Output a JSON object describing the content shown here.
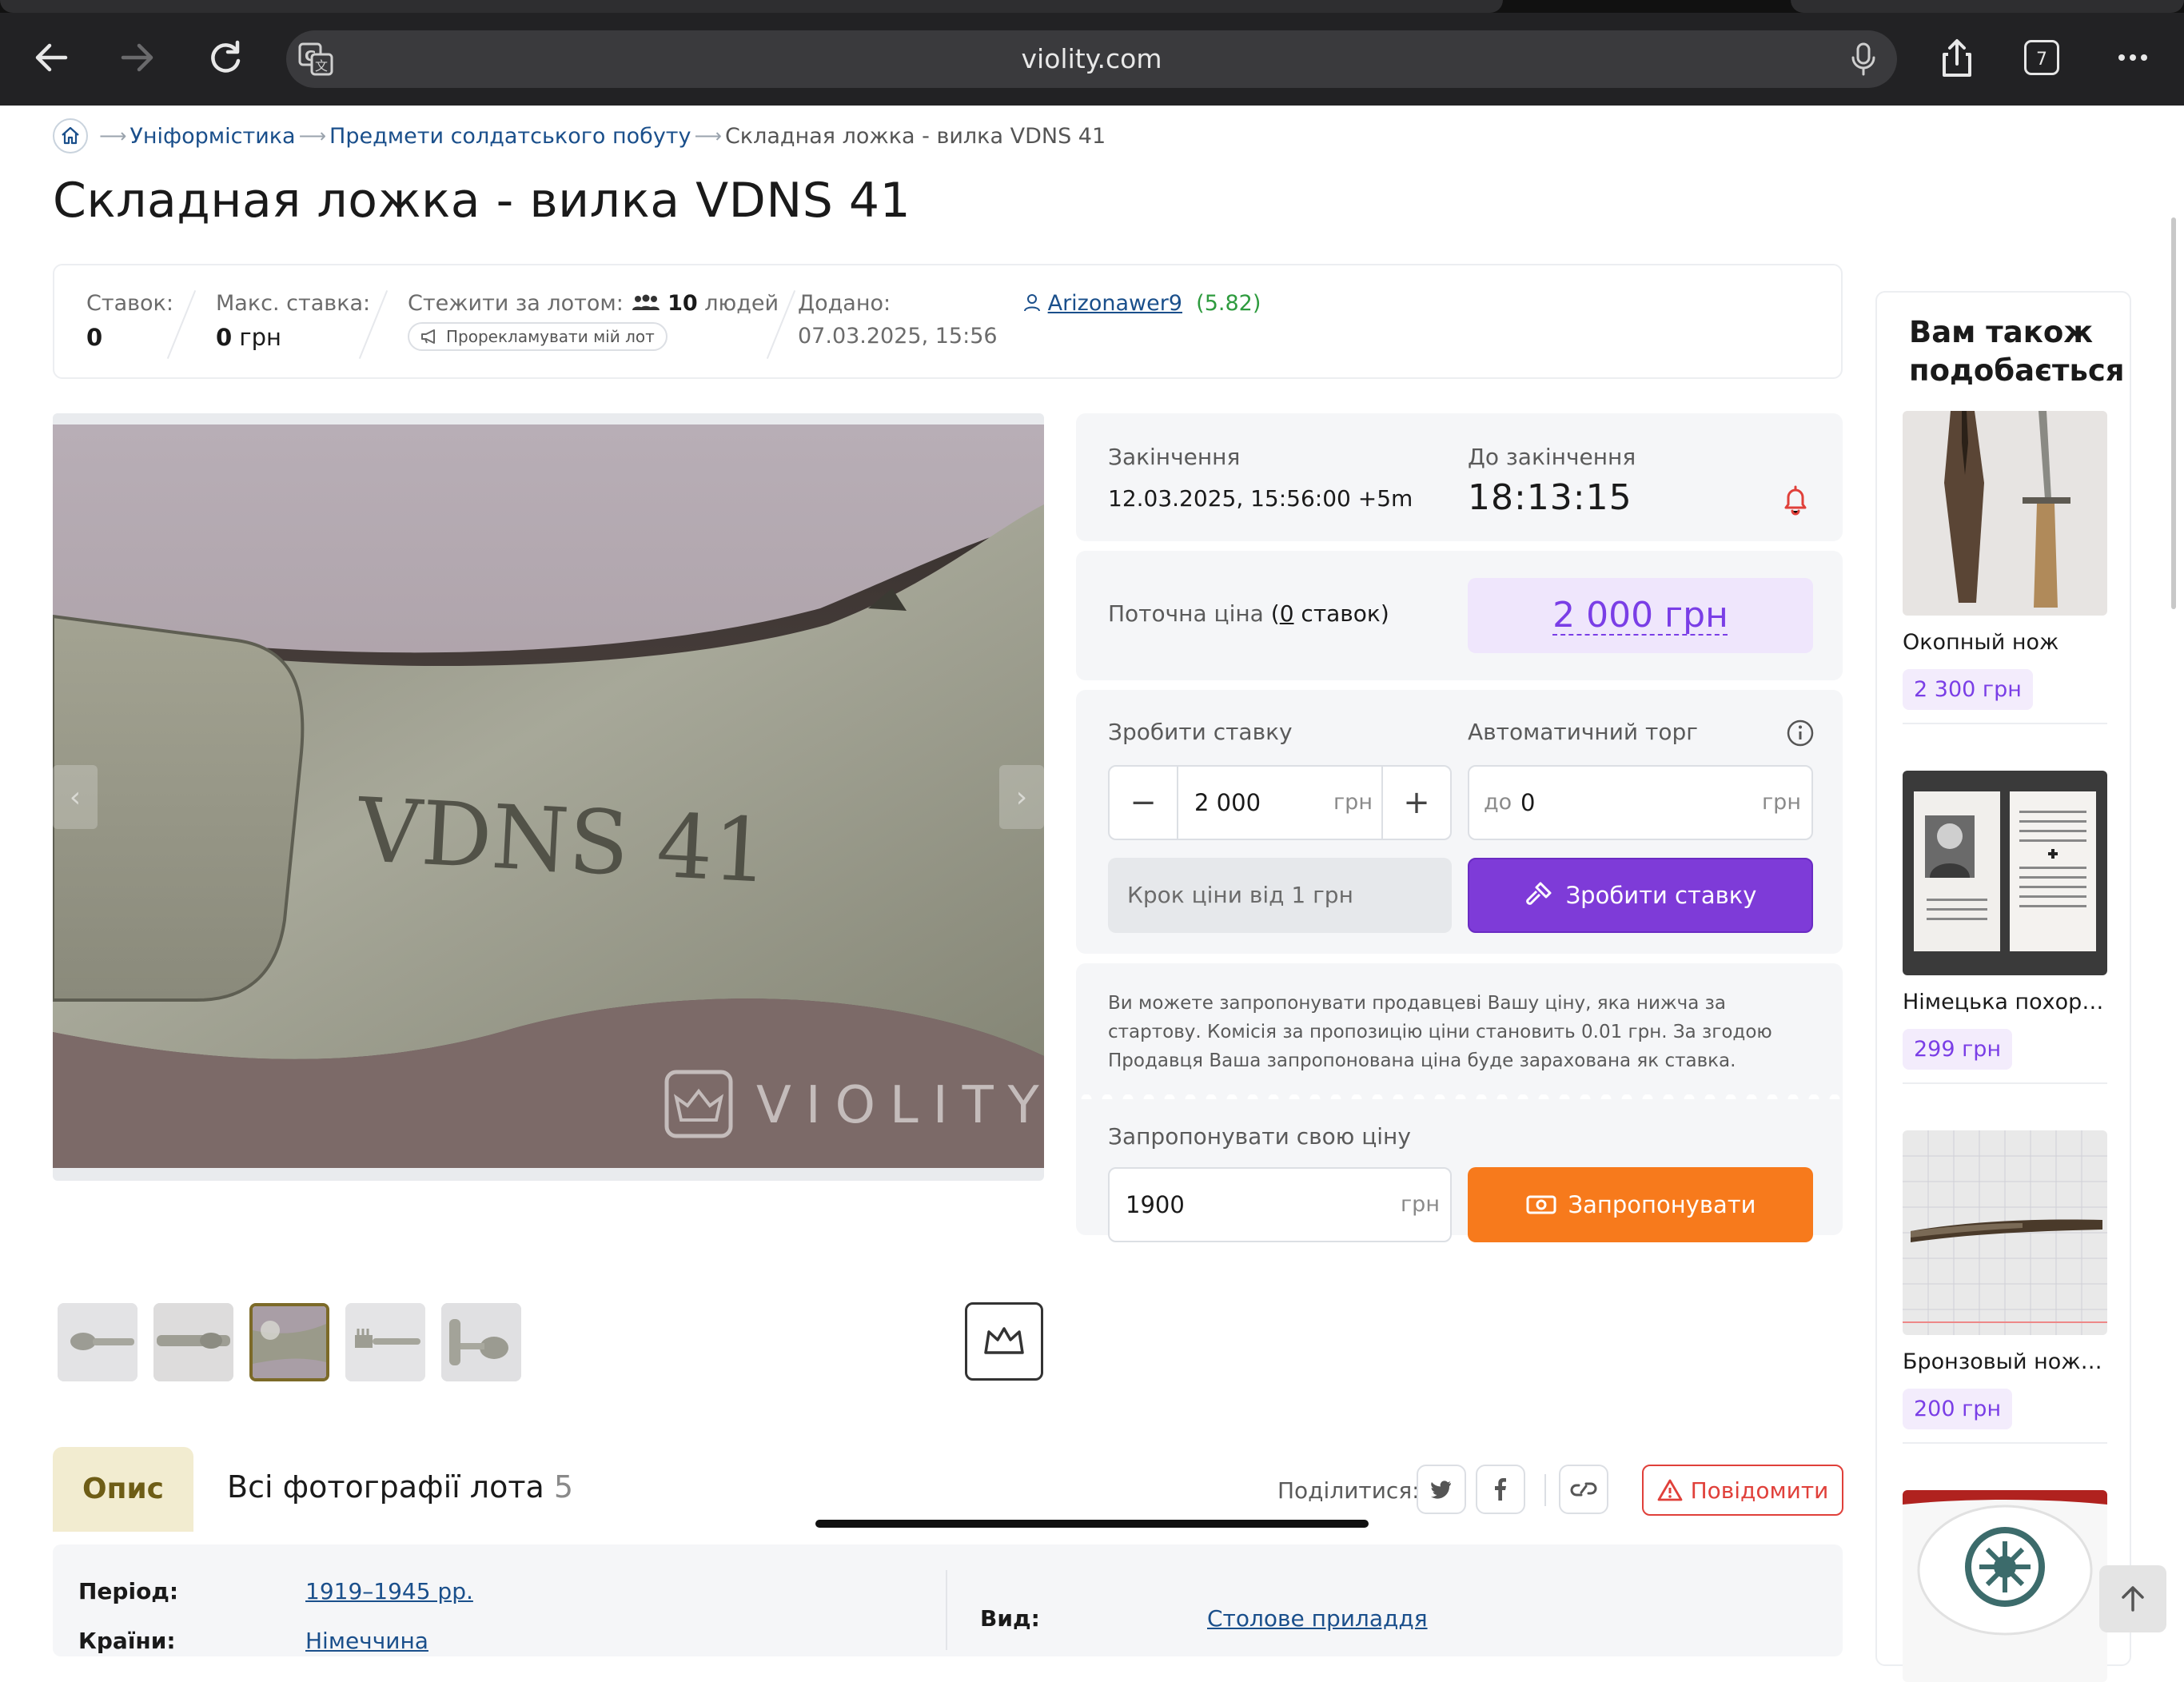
{
  "browser": {
    "url": "violity.com",
    "tab_count": "7"
  },
  "breadcrumbs": {
    "items": [
      "Уніформістика",
      "Предмети солдатського побуту"
    ],
    "current": "Складная ложка - вилка VDNS 41"
  },
  "lot": {
    "title": "Складная ложка - вилка VDNS 41"
  },
  "stats": {
    "bids_label": "Ставок:",
    "bids_value": "0",
    "max_bid_label": "Макс. ставка:",
    "max_bid_value": "0",
    "max_bid_unit": "грн",
    "watch_label": "Стежити за лотом:",
    "watch_count": "10",
    "watch_suffix": "людей",
    "promo_label": "Прорекламувати мій лот",
    "added_label": "Додано:",
    "added_value": "07.03.2025, 15:56",
    "seller_name": "Arizonawer9",
    "seller_rating": "(5.82)"
  },
  "gallery": {
    "watermark": "VIOLITY",
    "engraving": "VDNS 41",
    "thumb_count": 5,
    "active_thumb": 3
  },
  "auction": {
    "end_label": "Закінчення",
    "end_value": "12.03.2025, 15:56:00 +5m",
    "countdown_label": "До закінчення",
    "countdown_value": "18:13:15",
    "current_price_label": "Поточна ціна",
    "current_price_bids_link": "0",
    "current_price_bids_word": "ставок",
    "current_price": "2 000 грн",
    "bid_label": "Зробити ставку",
    "bid_value": "2 000",
    "bid_unit": "грн",
    "autobid_label": "Автоматичний торг",
    "autobid_prefix": "до",
    "autobid_value": "0",
    "autobid_unit": "грн",
    "step_label": "Крок ціни від 1 грн",
    "bid_button": "Зробити ставку",
    "offer_note": "Ви можете запропонувати продавцеві Вашу ціну, яка нижча за стартову. Комісія за пропозицію ціни становить 0.01 грн. За згодою Продавця Ваша запропонована ціна буде зарахована як ставка.",
    "offer_label": "Запропонувати свою ціну",
    "offer_value": "1900",
    "offer_unit": "грн",
    "offer_button": "Запропонувати"
  },
  "tabs": {
    "description": "Опис",
    "all_photos": "Всі фотографії лота",
    "all_photos_count": "5"
  },
  "share": {
    "label": "Поділитися:",
    "report": "Повідомити"
  },
  "specs": {
    "period_label": "Період:",
    "period_value": "1919–1945 рр.",
    "country_label": "Країни:",
    "country_value": "Німеччина",
    "type_label": "Вид:",
    "type_value": "Столове приладдя"
  },
  "sidebar": {
    "title": "Вам також подобається",
    "items": [
      {
        "name": "Окопный нож",
        "price": "2 300 грн"
      },
      {
        "name": "Німецька похоронка",
        "price": "299 грн"
      },
      {
        "name": "Бронзовый ножик",
        "price": "200 грн"
      }
    ]
  },
  "colors": {
    "accent_purple": "#7e3bd8",
    "accent_orange": "#f77a1c",
    "link_blue": "#1a4f8b",
    "alert_red": "#e0403a"
  }
}
